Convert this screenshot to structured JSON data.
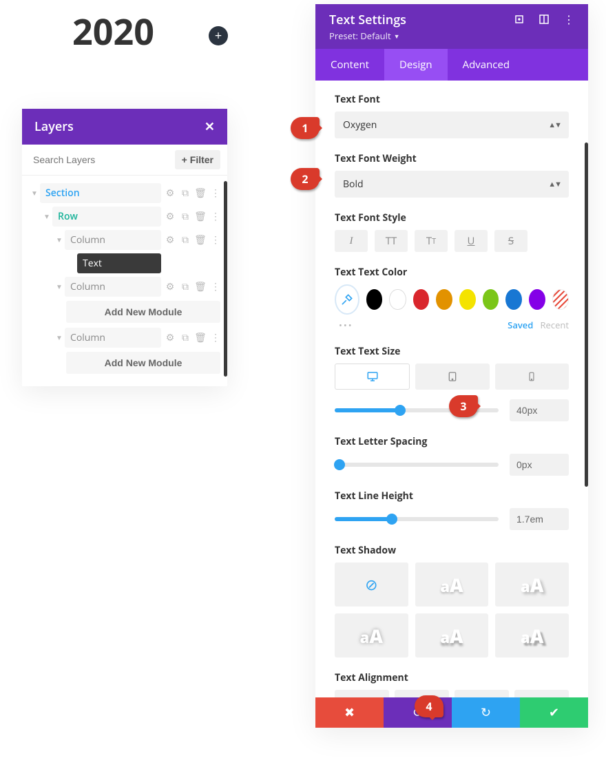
{
  "canvas": {
    "text": "2020"
  },
  "layers": {
    "title": "Layers",
    "search_placeholder": "Search Layers",
    "filter_label": "Filter",
    "items": {
      "section": "Section",
      "row": "Row",
      "col1": "Column",
      "text": "Text",
      "col2": "Column",
      "add1": "Add New Module",
      "col3": "Column",
      "add2": "Add New Module"
    }
  },
  "settings": {
    "title": "Text Settings",
    "preset_label": "Preset: Default",
    "tabs": {
      "content": "Content",
      "design": "Design",
      "advanced": "Advanced"
    },
    "font": {
      "label": "Text Font",
      "value": "Oxygen"
    },
    "weight": {
      "label": "Text Font Weight",
      "value": "Bold"
    },
    "style": {
      "label": "Text Font Style"
    },
    "color": {
      "label": "Text Text Color",
      "saved": "Saved",
      "recent": "Recent",
      "swatches": [
        "#000000",
        "#ffffff",
        "#d9262c",
        "#e29200",
        "#f4e300",
        "#7bc618",
        "#1877d3",
        "#8400e7"
      ]
    },
    "size": {
      "label": "Text Text Size",
      "value": "40px",
      "pct": 40
    },
    "spacing": {
      "label": "Text Letter Spacing",
      "value": "0px",
      "pct": 3
    },
    "lineheight": {
      "label": "Text Line Height",
      "value": "1.7em",
      "pct": 35
    },
    "shadow": {
      "label": "Text Shadow",
      "sample": "aA"
    },
    "align": {
      "label": "Text Alignment"
    }
  },
  "callouts": {
    "c1": "1",
    "c2": "2",
    "c3": "3",
    "c4": "4"
  }
}
